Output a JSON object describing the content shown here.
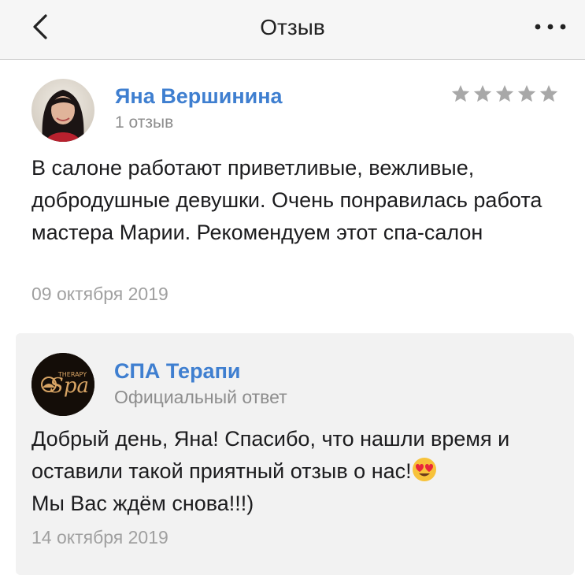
{
  "header": {
    "title": "Отзыв",
    "back_icon": "chevron-left-icon",
    "more_icon": "more-horizontal-icon"
  },
  "review": {
    "author": "Яна Вершинина",
    "review_count": "1 отзыв",
    "rating": 5,
    "rating_max": 5,
    "rating_color": "#a8a8a8",
    "text": "В салоне работают приветливые, вежливые, добродушные девушки. Очень понравилась работа мастера Марии. Рекомендуем этот спа-салон",
    "date": "09 октября 2019"
  },
  "reply": {
    "author": "СПА Терапи",
    "label": "Официальный ответ",
    "logo_text": "Spa",
    "logo_subtext": "THERAPY",
    "text_before_emoji": "Добрый день, Яна! Спасибо, что нашли время и оставили такой приятный отзыв о нас!",
    "emoji": "heart-eyes-emoji",
    "text_after_emoji": "Мы Вас ждём снова!!!)",
    "date": "14 октября 2019"
  },
  "colors": {
    "accent_link": "#3f7fd0",
    "secondary_text": "#8d8d8d",
    "date_text": "#a0a0a0",
    "header_bg": "#f6f6f6",
    "reply_bg": "#f2f2f2"
  }
}
